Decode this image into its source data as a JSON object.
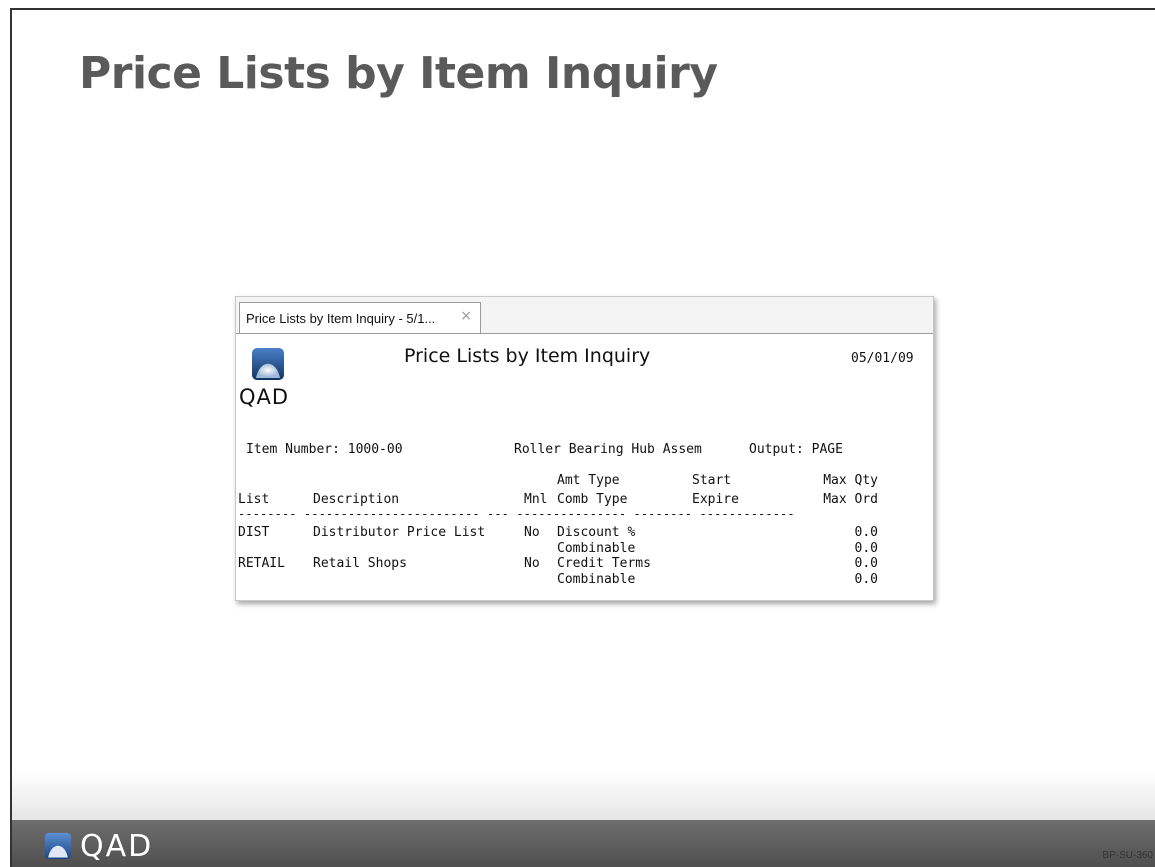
{
  "slide": {
    "title": "Price Lists by Item Inquiry",
    "footer_logo_text": "QAD",
    "slide_code": "BP-SU-360"
  },
  "window": {
    "tab_label": "Price Lists by Item Inquiry - 5/1...",
    "tab_close_glyph": "×",
    "logo_text": "QAD",
    "report_title": "Price Lists by Item Inquiry",
    "report_date": "05/01/09",
    "item_number_label": "Item Number: 1000-00",
    "item_description": "Roller Bearing Hub Assem",
    "output_label": "Output: PAGE"
  },
  "table": {
    "headers": {
      "list": "List",
      "description": "Description",
      "mnl": "Mnl",
      "amt_type": "Amt Type",
      "comb_type": "Comb Type",
      "start": "Start",
      "expire": "Expire",
      "max_qty": "Max Qty",
      "max_ord": "Max Ord"
    },
    "underline": "-------- ------------------------ --- --------------- -------- -------------",
    "rows": [
      {
        "list": "DIST",
        "description": "Distributor Price List",
        "mnl": "No",
        "amt_type": "Discount %",
        "comb_type": "Combinable",
        "start": "",
        "expire": "",
        "max_qty": "0.0",
        "max_ord": "0.0"
      },
      {
        "list": "RETAIL",
        "description": "Retail Shops",
        "mnl": "No",
        "amt_type": "Credit Terms",
        "comb_type": "Combinable",
        "start": "",
        "expire": "",
        "max_qty": "0.0",
        "max_ord": "0.0"
      }
    ]
  },
  "colors": {
    "title_gray": "#5a5a5a",
    "footer_bar": "#5a5a5a",
    "logo_blue": "#2a5fa8"
  }
}
